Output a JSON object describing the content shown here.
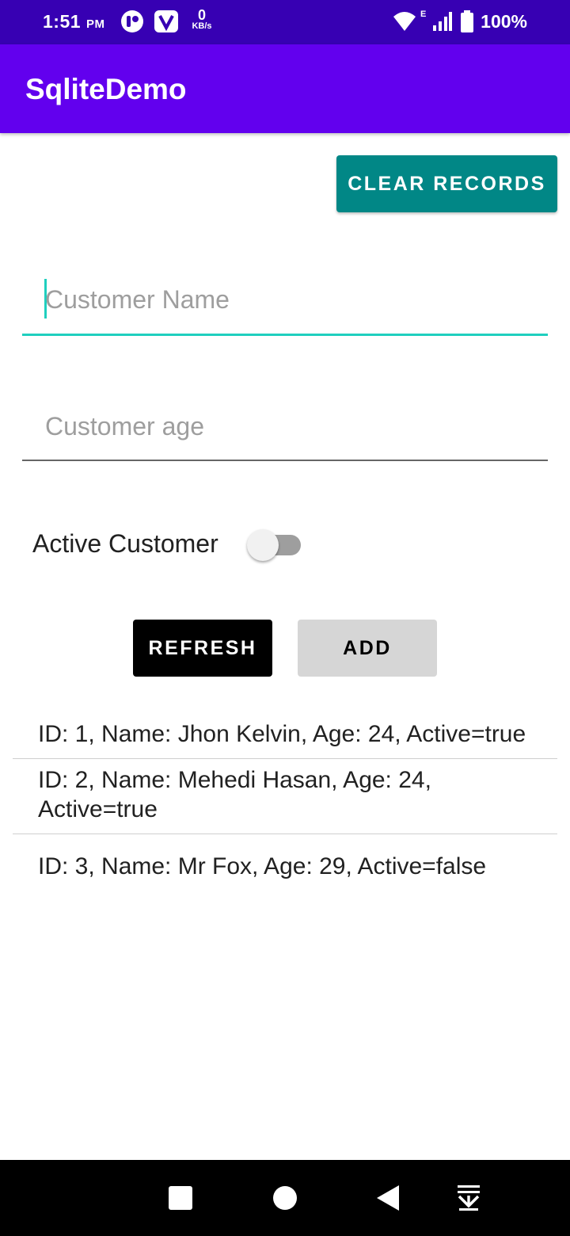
{
  "status_bar": {
    "time": "1:51",
    "ampm": "PM",
    "speed_value": "0",
    "speed_unit": "KB/s",
    "network": "E",
    "battery": "100%"
  },
  "app_bar": {
    "title": "SqliteDemo"
  },
  "clear_button": "CLEAR RECORDS",
  "name_field": {
    "placeholder": "Customer Name",
    "value": ""
  },
  "age_field": {
    "placeholder": "Customer age",
    "value": ""
  },
  "active_switch": {
    "label": "Active Customer",
    "checked": false
  },
  "refresh_button": "REFRESH",
  "add_button": "ADD",
  "records": [
    {
      "text": "ID: 1, Name: Jhon Kelvin, Age: 24, Active=true"
    },
    {
      "text": "ID: 2, Name: Mehedi Hasan, Age: 24, Active=true"
    },
    {
      "text": "ID: 3, Name: Mr Fox, Age: 29, Active=false"
    }
  ],
  "colors": {
    "status_bar": "#3700b3",
    "app_bar": "#6200ee",
    "clear_button": "#018786",
    "focused_underline": "#1fcfbe",
    "refresh_button": "#000000",
    "add_button": "#d6d6d6"
  },
  "nav_bar": {
    "icons": [
      "recents-square-icon",
      "home-circle-icon",
      "back-triangle-icon",
      "notification-pulldown-icon"
    ]
  }
}
